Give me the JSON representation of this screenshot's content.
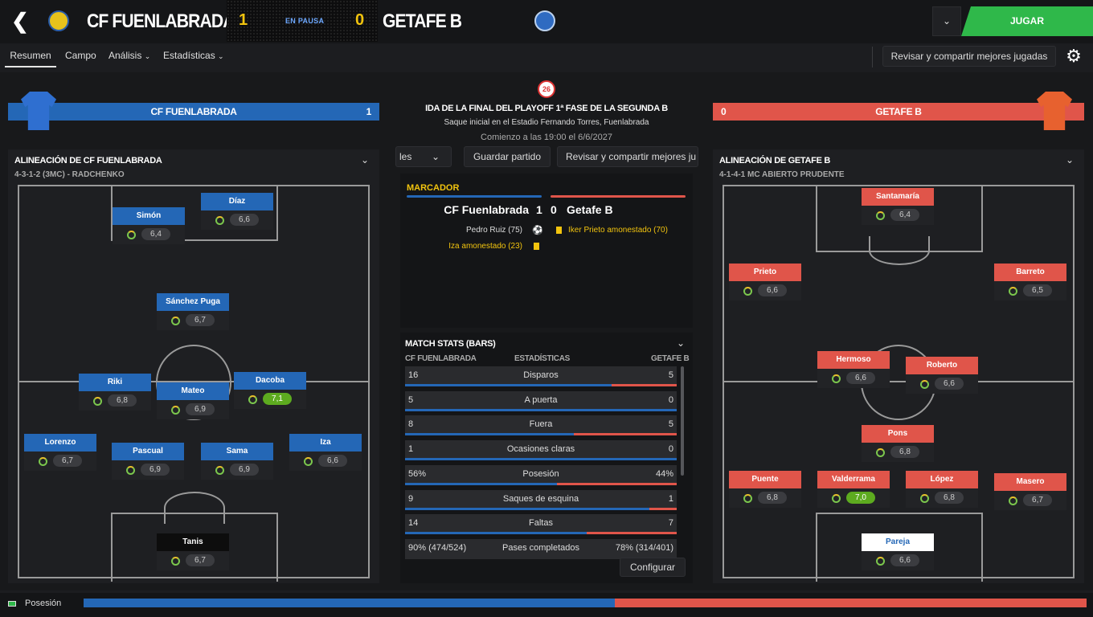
{
  "header": {
    "home_name": "CF FUENLABRADA",
    "away_name": "GETAFE B",
    "home_score": "1",
    "away_score": "0",
    "status": "EN PAUSA",
    "play_label": "JUGAR"
  },
  "tabs": [
    {
      "label": "Resumen"
    },
    {
      "label": "Campo"
    },
    {
      "label": "Análisis"
    },
    {
      "label": "Estadísticas"
    }
  ],
  "review_button": "Revisar y compartir mejores jugadas",
  "home": {
    "banner_name": "CF FUENLABRADA",
    "banner_score": "1",
    "lineup_title": "ALINEACIÓN DE CF FUENLABRADA",
    "formation": "4-3-1-2 (3MC) - RADCHENKO",
    "players": [
      {
        "name": "Simón",
        "rating": "6,4"
      },
      {
        "name": "Díaz",
        "rating": "6,6"
      },
      {
        "name": "Sánchez Puga",
        "rating": "6,7"
      },
      {
        "name": "Riki",
        "rating": "6,8"
      },
      {
        "name": "Mateo",
        "rating": "6,9"
      },
      {
        "name": "Dacoba",
        "rating": "7,1"
      },
      {
        "name": "Lorenzo",
        "rating": "6,7"
      },
      {
        "name": "Pascual",
        "rating": "6,9"
      },
      {
        "name": "Sama",
        "rating": "6,9"
      },
      {
        "name": "Iza",
        "rating": "6,6"
      },
      {
        "name": "Tanis",
        "rating": "6,7"
      }
    ]
  },
  "away": {
    "banner_name": "GETAFE B",
    "banner_score": "0",
    "lineup_title": "ALINEACIÓN DE GETAFE B",
    "formation": "4-1-4-1 MC ABIERTO PRUDENTE",
    "players": [
      {
        "name": "Santamaría",
        "rating": "6,4"
      },
      {
        "name": "Prieto",
        "rating": "6,6"
      },
      {
        "name": "Barreto",
        "rating": "6,5"
      },
      {
        "name": "Hermoso",
        "rating": "6,6"
      },
      {
        "name": "Roberto",
        "rating": "6,6"
      },
      {
        "name": "Pons",
        "rating": "6,8"
      },
      {
        "name": "Puente",
        "rating": "6,8"
      },
      {
        "name": "Valderrama",
        "rating": "7,0"
      },
      {
        "name": "López",
        "rating": "6,8"
      },
      {
        "name": "Masero",
        "rating": "6,7"
      },
      {
        "name": "Pareja",
        "rating": "6,6"
      }
    ]
  },
  "match": {
    "badge": "26",
    "competition": "IDA DE LA FINAL DEL PLAYOFF 1ª FASE DE LA SEGUNDA B",
    "venue": "Saque inicial en el Estadio Fernando Torres, Fuenlabrada",
    "kickoff": "Comienzo a las 19:00 el 6/6/2027",
    "partial_left": "les",
    "save_label": "Guardar partido",
    "review_partial": "Revisar y compartir mejores ju"
  },
  "scoreboard": {
    "title": "MARCADOR",
    "home": "CF Fuenlabrada",
    "home_score": "1",
    "away_score": "0",
    "away": "Getafe B",
    "home_events": [
      "Pedro Ruiz (75)",
      "Iza amonestado (23)"
    ],
    "away_events": [
      "Iker Prieto amonestado (70)"
    ]
  },
  "stats": {
    "title": "MATCH STATS (BARS)",
    "col_home": "CF FUENLABRADA",
    "col_mid": "ESTADÍSTICAS",
    "col_away": "GETAFE B",
    "configure": "Configurar",
    "rows": [
      {
        "home": "16",
        "name": "Disparos",
        "away": "5",
        "home_frac": 0.76
      },
      {
        "home": "5",
        "name": "A puerta",
        "away": "0",
        "home_frac": 1.0
      },
      {
        "home": "8",
        "name": "Fuera",
        "away": "5",
        "home_frac": 0.62
      },
      {
        "home": "1",
        "name": "Ocasiones claras",
        "away": "0",
        "home_frac": 1.0
      },
      {
        "home": "56%",
        "name": "Posesión",
        "away": "44%",
        "home_frac": 0.56
      },
      {
        "home": "9",
        "name": "Saques de esquina",
        "away": "1",
        "home_frac": 0.9
      },
      {
        "home": "14",
        "name": "Faltas",
        "away": "7",
        "home_frac": 0.67
      },
      {
        "home": "90% (474/524)",
        "name": "Pases completados",
        "away": "78% (314/401)",
        "home_frac": 0.5
      }
    ]
  },
  "footer": {
    "label": "Posesión",
    "home_frac": 0.53
  },
  "colors": {
    "home": "#2467b6",
    "away": "#e0554a",
    "accent": "#f2c40e",
    "play": "#2fb84a"
  }
}
